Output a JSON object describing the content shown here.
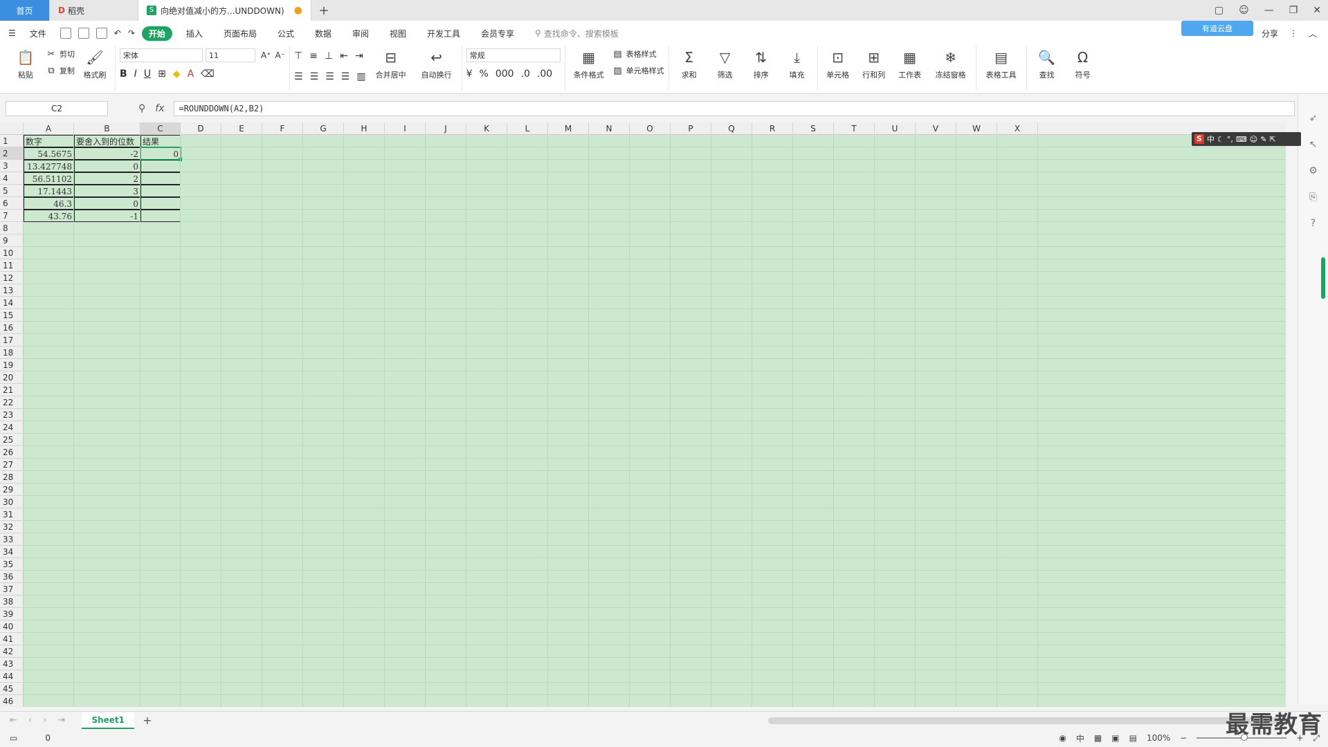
{
  "tabs": {
    "home": "首页",
    "docer": "稻壳",
    "active_doc": "向绝对值减小的方...UNDDOWN)",
    "add": "+"
  },
  "menu": {
    "file": "文件",
    "items": [
      "开始",
      "插入",
      "页面布局",
      "公式",
      "数据",
      "审阅",
      "视图",
      "开发工具",
      "会员专享"
    ],
    "search_placeholder": "查找命令、搜索模板",
    "cloud_badge": "有道云盘",
    "share": "分享"
  },
  "ribbon": {
    "paste": "粘贴",
    "cut": "剪切",
    "copy": "复制",
    "format_painter": "格式刷",
    "font_name": "宋体",
    "font_size": "11",
    "merge_center": "合并居中",
    "wrap_text": "自动换行",
    "number_format": "常规",
    "conditional_format": "条件格式",
    "table_style": "表格样式",
    "cell_style": "单元格样式",
    "sum": "求和",
    "filter": "筛选",
    "sort": "排序",
    "fill": "填充",
    "cells": "单元格",
    "rows_cols": "行和列",
    "worksheet": "工作表",
    "freeze": "冻结窗格",
    "table_tools": "表格工具",
    "find": "查找",
    "symbol": "符号"
  },
  "formula_bar": {
    "name_box": "C2",
    "formula": "=ROUNDDOWN(A2,B2)"
  },
  "columns": [
    "A",
    "B",
    "C",
    "D",
    "E",
    "F",
    "G",
    "H",
    "I",
    "J",
    "K",
    "L",
    "M",
    "N",
    "O",
    "P",
    "Q",
    "R",
    "S",
    "T",
    "U",
    "V",
    "W",
    "X"
  ],
  "rows": [
    "1",
    "2",
    "3",
    "4",
    "5",
    "6",
    "7",
    "8",
    "9",
    "10",
    "11",
    "12",
    "13",
    "14",
    "15",
    "16",
    "17",
    "18",
    "19",
    "20",
    "21",
    "22",
    "23",
    "24",
    "25",
    "26",
    "27",
    "28",
    "29",
    "30",
    "31",
    "32",
    "33",
    "34",
    "35",
    "36",
    "37",
    "38",
    "39",
    "40",
    "41",
    "42",
    "43",
    "44",
    "45",
    "46"
  ],
  "table": {
    "headers": [
      "数字",
      "要舍入到的位数",
      "结果"
    ],
    "rows": [
      [
        "54.5675",
        "-2",
        "0"
      ],
      [
        "13.427748",
        "0",
        ""
      ],
      [
        "56.51102",
        "2",
        ""
      ],
      [
        "17.1443",
        "3",
        ""
      ],
      [
        "46.3",
        "0",
        ""
      ],
      [
        "43.76",
        "-1",
        ""
      ]
    ]
  },
  "ime": {
    "label": "中"
  },
  "sheet": {
    "name": "Sheet1"
  },
  "status": {
    "value": "0",
    "zoom": "100%"
  },
  "watermark": "最需教育",
  "colors": {
    "accent": "#1ea362",
    "grid_bg": "#cce8cf",
    "tab_home": "#3b8ee0"
  }
}
